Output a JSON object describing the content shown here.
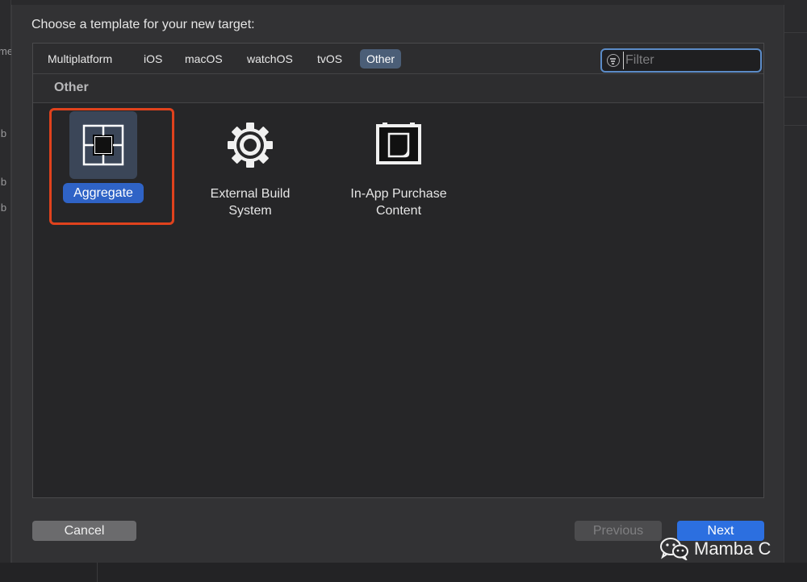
{
  "backdrop": {
    "left_fragments": [
      "me",
      "ib",
      "ib",
      "ib"
    ]
  },
  "dialog": {
    "title": "Choose a template for your new target:",
    "tabs": [
      {
        "label": "Multiplatform",
        "active": false
      },
      {
        "label": "iOS",
        "active": false
      },
      {
        "label": "macOS",
        "active": false
      },
      {
        "label": "watchOS",
        "active": false
      },
      {
        "label": "tvOS",
        "active": false
      },
      {
        "label": "Other",
        "active": true
      }
    ],
    "filter": {
      "placeholder": "Filter",
      "value": ""
    },
    "section_label": "Other",
    "templates": [
      {
        "label": "Aggregate",
        "icon": "aggregate-icon",
        "selected": true
      },
      {
        "label": "External Build System",
        "label_lines": [
          "External Build",
          "System"
        ],
        "icon": "gear-icon",
        "selected": false
      },
      {
        "label": "In-App Purchase Content",
        "label_lines": [
          "In-App Purchase",
          "Content"
        ],
        "icon": "in-app-purchase-icon",
        "selected": false
      }
    ],
    "buttons": {
      "cancel": "Cancel",
      "previous": "Previous",
      "next": "Next"
    }
  },
  "watermark": {
    "icon": "wechat-icon",
    "text": "Mamba C"
  },
  "colors": {
    "accent": "#2c6fe0",
    "selected_tab": "#4b5e77",
    "highlight_border": "#e0421d",
    "filter_focus": "#5b8bc7"
  }
}
